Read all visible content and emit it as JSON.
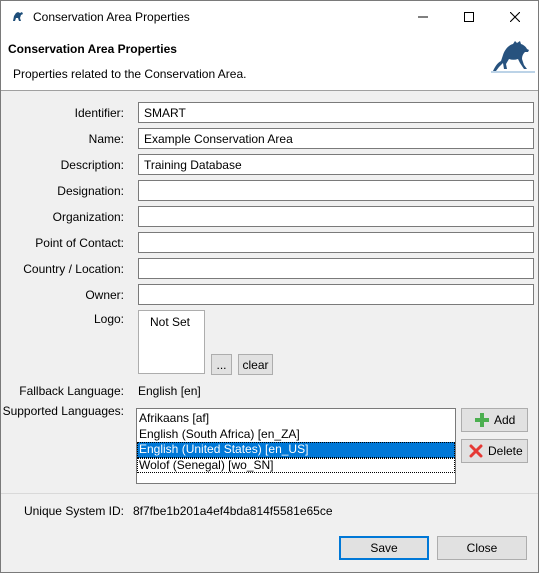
{
  "window": {
    "title": "Conservation Area Properties"
  },
  "header": {
    "title": "Conservation Area Properties",
    "description": "Properties related to the Conservation Area."
  },
  "form": {
    "identifier_label": "Identifier:",
    "identifier_value": "SMART",
    "name_label": "Name:",
    "name_value": "Example Conservation Area",
    "description_label": "Description:",
    "description_value": "Training Database",
    "designation_label": "Designation:",
    "designation_value": "",
    "organization_label": "Organization:",
    "organization_value": "",
    "contact_label": "Point of Contact:",
    "contact_value": "",
    "country_label": "Country / Location:",
    "country_value": "",
    "owner_label": "Owner:",
    "owner_value": "",
    "logo_label": "Logo:",
    "logo_value": "Not Set",
    "logo_browse_label": "...",
    "logo_clear_label": "clear",
    "fallback_label": "Fallback Language:",
    "fallback_value": "English [en]",
    "supported_label": "Supported Languages:",
    "languages": [
      "Afrikaans [af]",
      "English (South Africa) [en_ZA]",
      "English (United States) [en_US]",
      "Wolof (Senegal) [wo_SN]"
    ],
    "selected_language": "English (United States) [en_US]",
    "add_label": "Add",
    "delete_label": "Delete",
    "uid_label": "Unique System ID:",
    "uid_value": "8f7fbe1b201a4ef4bda814f5581e65ce"
  },
  "footer": {
    "save_label": "Save",
    "close_label": "Close"
  },
  "colors": {
    "selection": "#0078d7",
    "add_icon": "#4caf50",
    "delete_icon": "#e53935"
  },
  "icons": [
    "app-icon",
    "minimize-icon",
    "maximize-icon",
    "close-icon",
    "brand-logo-icon",
    "add-icon",
    "delete-icon"
  ]
}
